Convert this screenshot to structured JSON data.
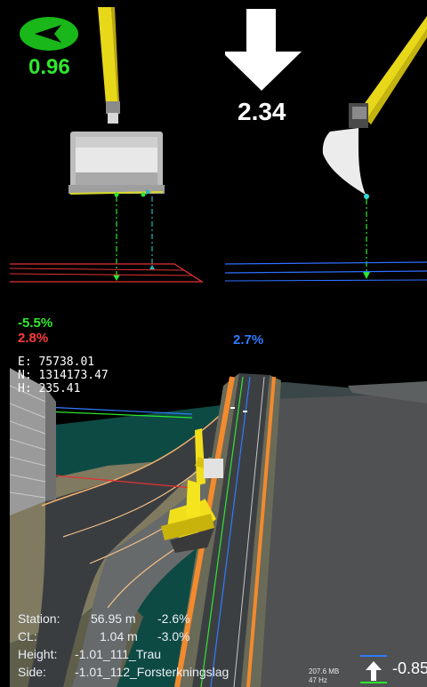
{
  "front_view": {
    "cross_slope_value": "0.96",
    "grade_main": "-5.5%",
    "grade_secondary": "2.8%",
    "icon": "compass-arrow-icon"
  },
  "side_view": {
    "height_value": "2.34",
    "grade": "2.7%",
    "icon": "down-arrow-icon"
  },
  "coordinates": {
    "e_label": "E:",
    "e_value": "75738.01",
    "n_label": "N:",
    "n_value": "1314173.47",
    "h_label": "H:",
    "h_value": "235.41"
  },
  "status_hud": {
    "station_label": "Station:",
    "station_value": "56.95 m",
    "station_grade": "-2.6%",
    "cl_label": "CL:",
    "cl_value": "1.04 m",
    "cl_grade": "-3.0%",
    "height_label": "Height:",
    "height_value": "-1.01_111_Trau",
    "side_label": "Side:",
    "side_value": "-1.01_112_Forsterkningslag"
  },
  "system": {
    "memory": "207.6 MB",
    "frequency": "47 Hz"
  },
  "elevation_indicator": {
    "value": "-0.85",
    "icon": "up-arrow-icon"
  },
  "colors": {
    "green": "#2ee82e",
    "red": "#ff3b3b",
    "blue": "#2f7bff",
    "yellow": "#f2df1c",
    "orange": "#f28a2e"
  }
}
